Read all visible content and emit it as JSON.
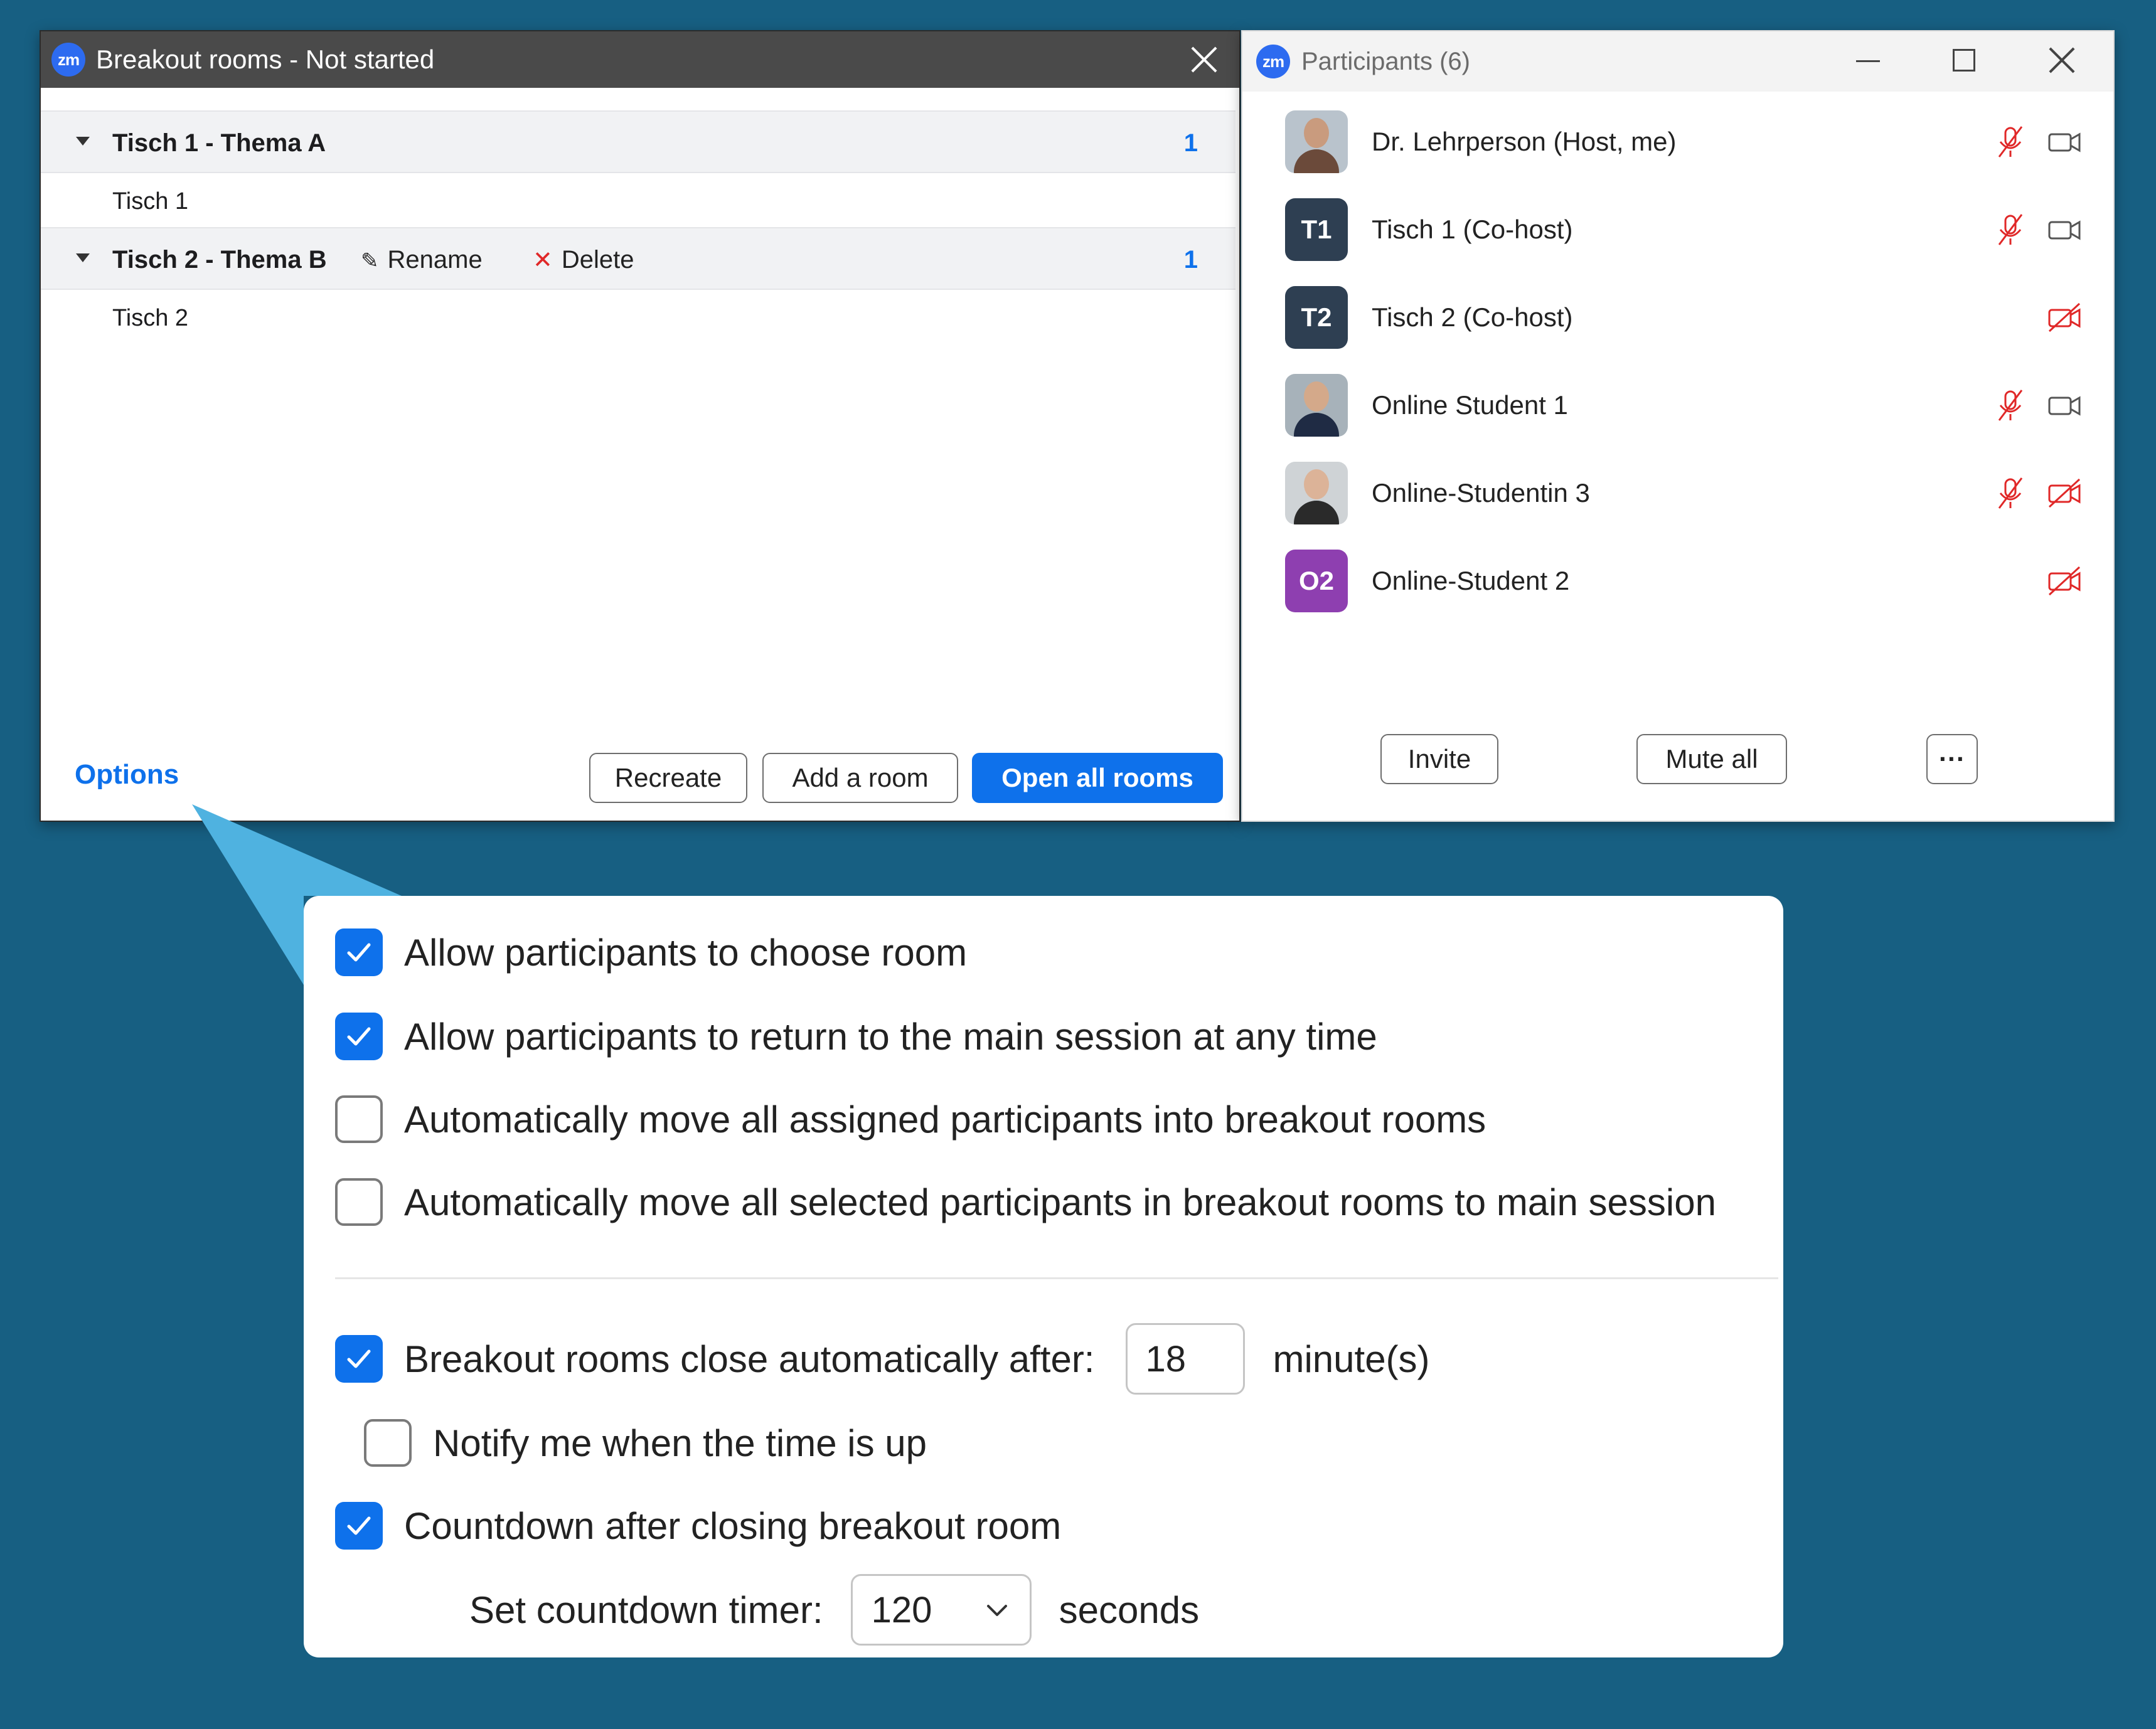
{
  "breakout": {
    "title": "Breakout rooms - Not started",
    "rooms": [
      {
        "name": "Tisch 1 - Thema A",
        "count": "1",
        "members": [
          "Tisch 1"
        ]
      },
      {
        "name": "Tisch 2 - Thema B",
        "count": "1",
        "members": [
          "Tisch 2"
        ],
        "rename_label": "Rename",
        "delete_label": "Delete"
      }
    ],
    "options_label": "Options",
    "buttons": {
      "recreate": "Recreate",
      "add_room": "Add a room",
      "open_all": "Open all rooms"
    },
    "logo_text": "zm"
  },
  "participants": {
    "title": "Participants (6)",
    "logo_text": "zm",
    "list": [
      {
        "name": "Dr. Lehrperson (Host, me)",
        "avatar": "photo",
        "mic": "muted",
        "video": "on"
      },
      {
        "name": "Tisch 1 (Co-host)",
        "avatar_initials": "T1",
        "avatar_color": "#2e3f52",
        "mic": "muted",
        "video": "on"
      },
      {
        "name": "Tisch 2 (Co-host)",
        "avatar_initials": "T2",
        "avatar_color": "#2e3f52",
        "mic": "none",
        "video": "off"
      },
      {
        "name": "Online Student 1",
        "avatar": "photo",
        "mic": "muted",
        "video": "on"
      },
      {
        "name": "Online-Studentin 3",
        "avatar": "photo",
        "mic": "muted",
        "video": "off"
      },
      {
        "name": "Online-Student 2",
        "avatar_initials": "O2",
        "avatar_color": "#8e3fb0",
        "mic": "none",
        "video": "off"
      }
    ],
    "buttons": {
      "invite": "Invite",
      "mute_all": "Mute all",
      "more": "···"
    }
  },
  "options": {
    "allow_choose": {
      "label": "Allow participants to choose room",
      "checked": true
    },
    "allow_return": {
      "label": "Allow participants to return to the main session at any time",
      "checked": true
    },
    "auto_move_in": {
      "label": "Automatically move all assigned participants into breakout rooms",
      "checked": false
    },
    "auto_move_out": {
      "label": "Automatically move all selected participants in breakout rooms to main session",
      "checked": false
    },
    "auto_close": {
      "label": "Breakout rooms close automatically after:",
      "checked": true,
      "value": "18",
      "unit": "minute(s)"
    },
    "notify": {
      "label": "Notify me when the time is up",
      "checked": false
    },
    "countdown": {
      "label": "Countdown after closing breakout room",
      "checked": true
    },
    "countdown_timer": {
      "label": "Set countdown timer:",
      "value": "120",
      "unit": "seconds"
    }
  },
  "colors": {
    "background": "#175f82",
    "accent": "#0e71eb",
    "muted_red": "#e02828"
  }
}
